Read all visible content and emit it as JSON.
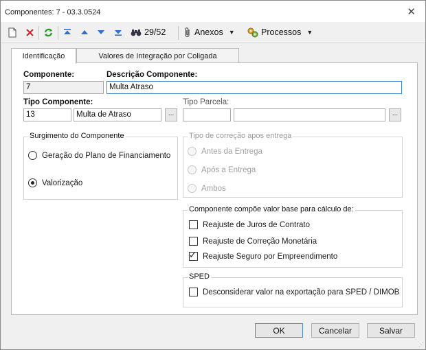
{
  "window": {
    "title": "Componentes: 7 - 03.3.0524"
  },
  "toolbar": {
    "record_counter": "29/52",
    "anexos_label": "Anexos",
    "processos_label": "Processos"
  },
  "tabs": [
    {
      "label": "Identificação",
      "active": true
    },
    {
      "label": "Valores de Integração por Coligada",
      "active": false
    }
  ],
  "form": {
    "componente_label": "Componente:",
    "componente_value": "7",
    "descricao_label": "Descrição Componente:",
    "descricao_value": "Multa Atraso",
    "tipo_componente_label": "Tipo Componente:",
    "tipo_componente_code": "13",
    "tipo_componente_desc": "Multa de Atraso",
    "tipo_parcela_label": "Tipo Parcela:",
    "tipo_parcela_code": "",
    "tipo_parcela_desc": "",
    "lookup_button": "..."
  },
  "surgimento": {
    "legend": "Surgimento do Componente",
    "options": [
      {
        "label": "Geração do Plano de Financiamento",
        "selected": false
      },
      {
        "label": "Valorização",
        "selected": true
      }
    ]
  },
  "tipo_correcao": {
    "legend": "Tipo de correção apos entrega",
    "options": [
      {
        "label": "Antes da Entrega",
        "selected": false
      },
      {
        "label": "Após a Entrega",
        "selected": false
      },
      {
        "label": "Ambos",
        "selected": false
      }
    ]
  },
  "calculo": {
    "legend": "Componente compõe valor base para cálculo de:",
    "options": [
      {
        "label": "Reajuste de Juros de Contrato",
        "checked": false
      },
      {
        "label": "Reajuste de Correção Monetária",
        "checked": false
      },
      {
        "label": "Reajuste Seguro por Empreendimento",
        "checked": true
      }
    ]
  },
  "sped": {
    "legend": "SPED",
    "option": {
      "label": "Desconsiderar valor na exportação para SPED / DIMOB",
      "checked": false
    }
  },
  "footer": {
    "ok": "OK",
    "cancel": "Cancelar",
    "save": "Salvar"
  },
  "colors": {
    "delete_red": "#d9242b",
    "refresh_green": "#2e9b2e",
    "nav_blue": "#2f6fcf",
    "focus_border": "#3c82c8"
  }
}
